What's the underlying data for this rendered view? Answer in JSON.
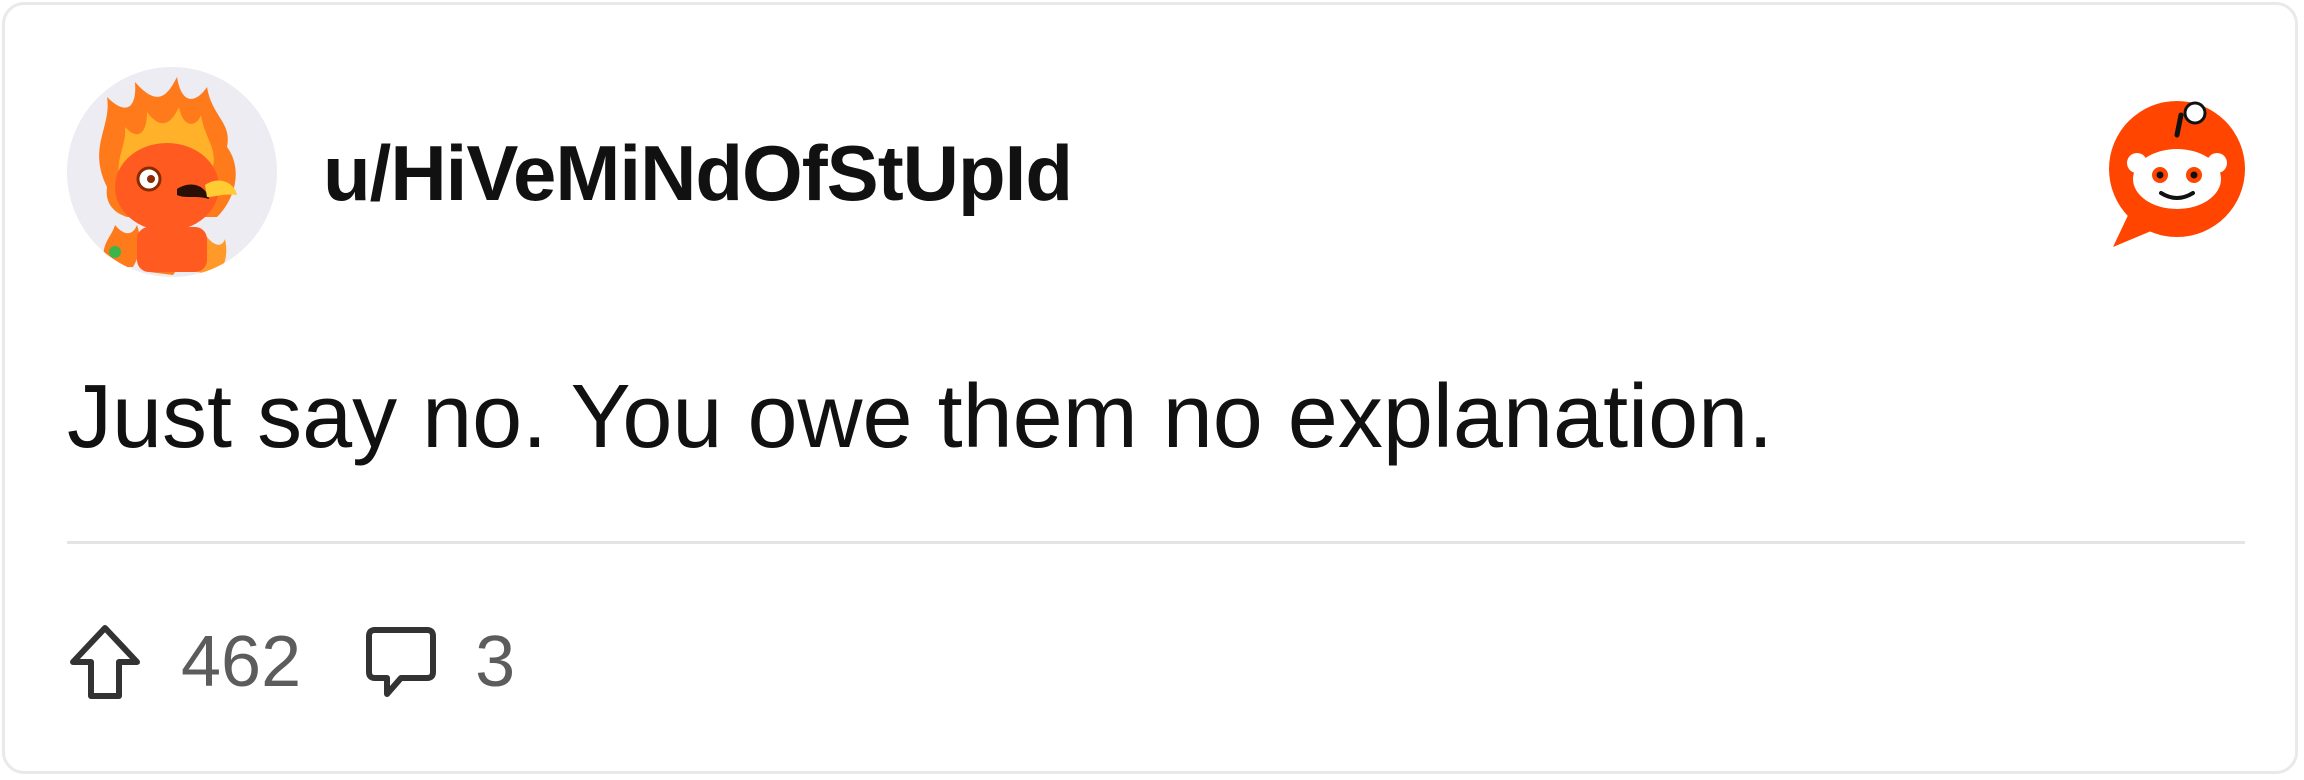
{
  "post": {
    "username": "u/HiVeMiNdOfStUpId",
    "comment_text": "Just say no. You owe them no explanation.",
    "upvote_count": "462",
    "comment_count": "3"
  },
  "icons": {
    "avatar": "fire-character-avatar",
    "brand": "reddit-logo-icon",
    "upvote": "upvote-arrow-icon",
    "comments": "comment-bubble-icon"
  },
  "colors": {
    "brand_orange": "#ff4500",
    "text_primary": "#111111",
    "text_secondary": "#5c5c5c",
    "divider": "#e4e4e4"
  }
}
